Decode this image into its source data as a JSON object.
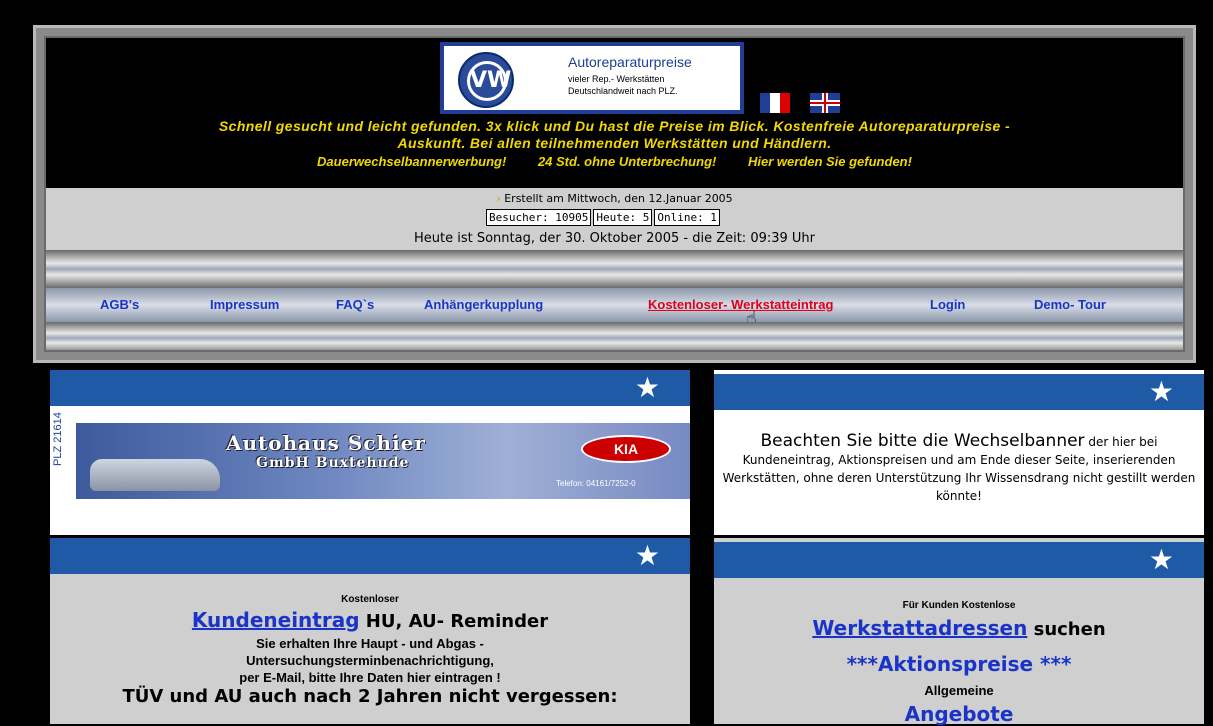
{
  "header": {
    "logo": {
      "title": "Autoreparaturpreise",
      "line1": "vieler Rep.- Werkstätten",
      "line2": "Deutschlandweit nach PLZ.",
      "mark": "VW"
    },
    "slogan_line1": "Schnell gesucht und leicht gefunden. 3x klick und Du hast die Preise im Blick. Kostenfreie Autoreparaturpreise -",
    "slogan_line2": "Auskunft. Bei allen teilnehmenden Werkstätten und Händlern.",
    "slogan_line3": [
      "Dauerwechselbannerwerbung!",
      "24 Std. ohne Unterbrechung!",
      "Hier werden Sie gefunden!"
    ],
    "created": "Erstellt am Mittwoch, den 12.Januar 2005",
    "counter": {
      "visitors": "Besucher: 10905",
      "today": "Heute: 5",
      "online": "Online: 1"
    },
    "today_text": "Heute ist Sonntag, der 30. Oktober 2005 - die Zeit: 09:39 Uhr",
    "flags": [
      "fr-flag",
      "uk-flag"
    ]
  },
  "nav": [
    {
      "label": "AGB's"
    },
    {
      "label": "Impressum"
    },
    {
      "label": "FAQ`s"
    },
    {
      "label": "Anhängerkupplung"
    },
    {
      "label": "Kostenloser- Werkstatteintrag"
    },
    {
      "label": "Login"
    },
    {
      "label": "Demo- Tour"
    }
  ],
  "banner": {
    "plz": "PLZ  21614",
    "title": "Autohaus Schier",
    "subtitle": "GmbH Buxtehude",
    "brand": "KIA",
    "phone": "Telefon: 04161/7252-0"
  },
  "notice": {
    "big": "Beachten Sie bitte die Wechselbanner",
    "rest": " der hier bei Kundeneintrag, Aktionspreisen und am Ende dieser Seite, inserierenden  Werkstätten, ohne deren Unterstützung Ihr Wissensdrang nicht gestillt werden könnte!"
  },
  "left_box": {
    "kicker": "Kostenloser",
    "link": "Kundeneintrag",
    "link_after": " HU, AU- Reminder",
    "line1": "Sie erhalten Ihre Haupt - und Abgas -",
    "line2": "Untersuchungsterminbenachrichtigung,",
    "line3": "per E-Mail,  bitte Ihre Daten hier eintragen !",
    "line4": "TÜV und AU auch nach 2 Jahren nicht vergessen:"
  },
  "right_box": {
    "kicker": "Für Kunden Kostenlose",
    "link": "Werkstattadressen",
    "link_after": " suchen",
    "aktion": "***Aktionspreise ***",
    "allgemeine": "Allgemeine",
    "angebote": "Angebote"
  },
  "colors": {
    "slogan": "#f0d800",
    "nav_link": "#1a34c8",
    "nav_active": "#e0001c",
    "section_head": "#1f5aa6"
  }
}
